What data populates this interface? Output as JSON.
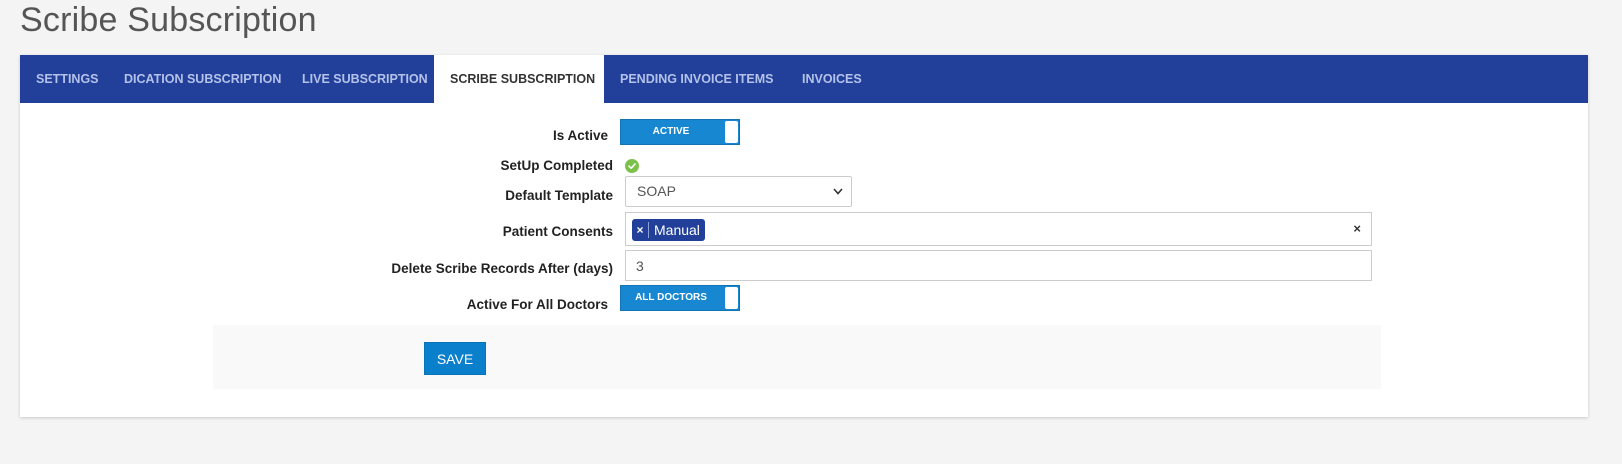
{
  "page": {
    "title": "Scribe Subscription"
  },
  "tabs": [
    {
      "label": "SETTINGS",
      "active": false
    },
    {
      "label": "DICATION SUBSCRIPTION",
      "active": false
    },
    {
      "label": "LIVE SUBSCRIPTION",
      "active": false
    },
    {
      "label": "SCRIBE SUBSCRIPTION",
      "active": true
    },
    {
      "label": "PENDING INVOICE ITEMS",
      "active": false
    },
    {
      "label": "INVOICES",
      "active": false
    }
  ],
  "form": {
    "is_active": {
      "label": "Is Active",
      "toggle_text": "ACTIVE",
      "on": true
    },
    "setup_completed": {
      "label": "SetUp Completed",
      "icon": "check-circle-icon",
      "done": true
    },
    "default_template": {
      "label": "Default Template",
      "value": "SOAP"
    },
    "patient_consents": {
      "label": "Patient Consents",
      "chips": [
        "Manual"
      ],
      "chip_remove": "×",
      "clear": "×"
    },
    "delete_after": {
      "label": "Delete Scribe Records After (days)",
      "value": "3"
    },
    "active_all_doctors": {
      "label": "Active For All Doctors",
      "toggle_text": "ALL DOCTORS",
      "on": true
    }
  },
  "footer": {
    "save_label": "SAVE"
  },
  "colors": {
    "tabbar": "#22409a",
    "toggle": "#1687d0",
    "chip": "#22409a",
    "check": "#7cc14a",
    "save": "#0a7fcc"
  }
}
